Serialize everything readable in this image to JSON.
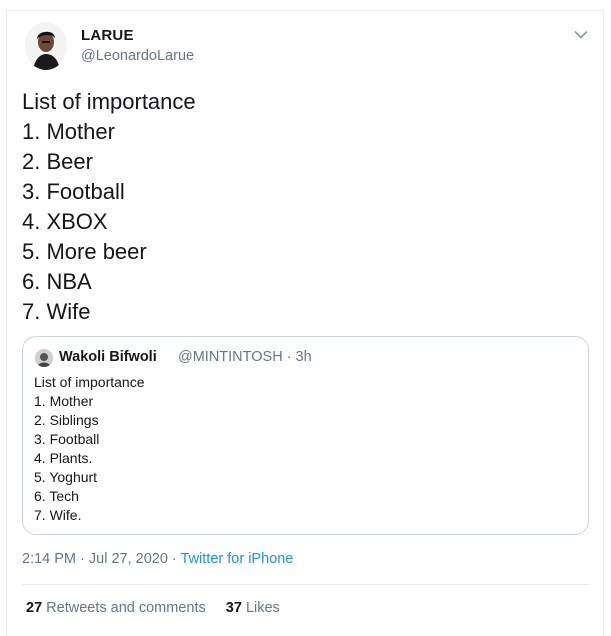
{
  "tweet": {
    "author_name": "LARUE",
    "author_handle": "@LeonardoLarue",
    "lines": [
      "List of importance",
      "1. Mother",
      "2. Beer",
      "3. Football",
      "4. XBOX",
      "5. More beer",
      "6. NBA",
      "7. Wife"
    ],
    "timestamp": "2:14 PM · Jul 27, 2020 · ",
    "source": "Twitter for iPhone",
    "retweets_count": "27",
    "retweets_label": "Retweets and comments",
    "likes_count": "37",
    "likes_label": "Likes"
  },
  "quoted_tweet": {
    "author_name": "Wakoli Bifwoli",
    "author_handle": "@MINTINTOSH · 3h",
    "lines": [
      "List of importance",
      "1. Mother",
      "2. Siblings",
      "3. Football",
      "4. Plants.",
      "5. Yoghurt",
      "6. Tech",
      "7. Wife."
    ]
  },
  "icons": {
    "menu": "chevron-down-icon",
    "avatar": "avatar",
    "quoted_avatar": "avatar"
  },
  "colors": {
    "accent": "#1b95e0",
    "secondary_text": "#657786",
    "border": "#ccd6dd"
  }
}
